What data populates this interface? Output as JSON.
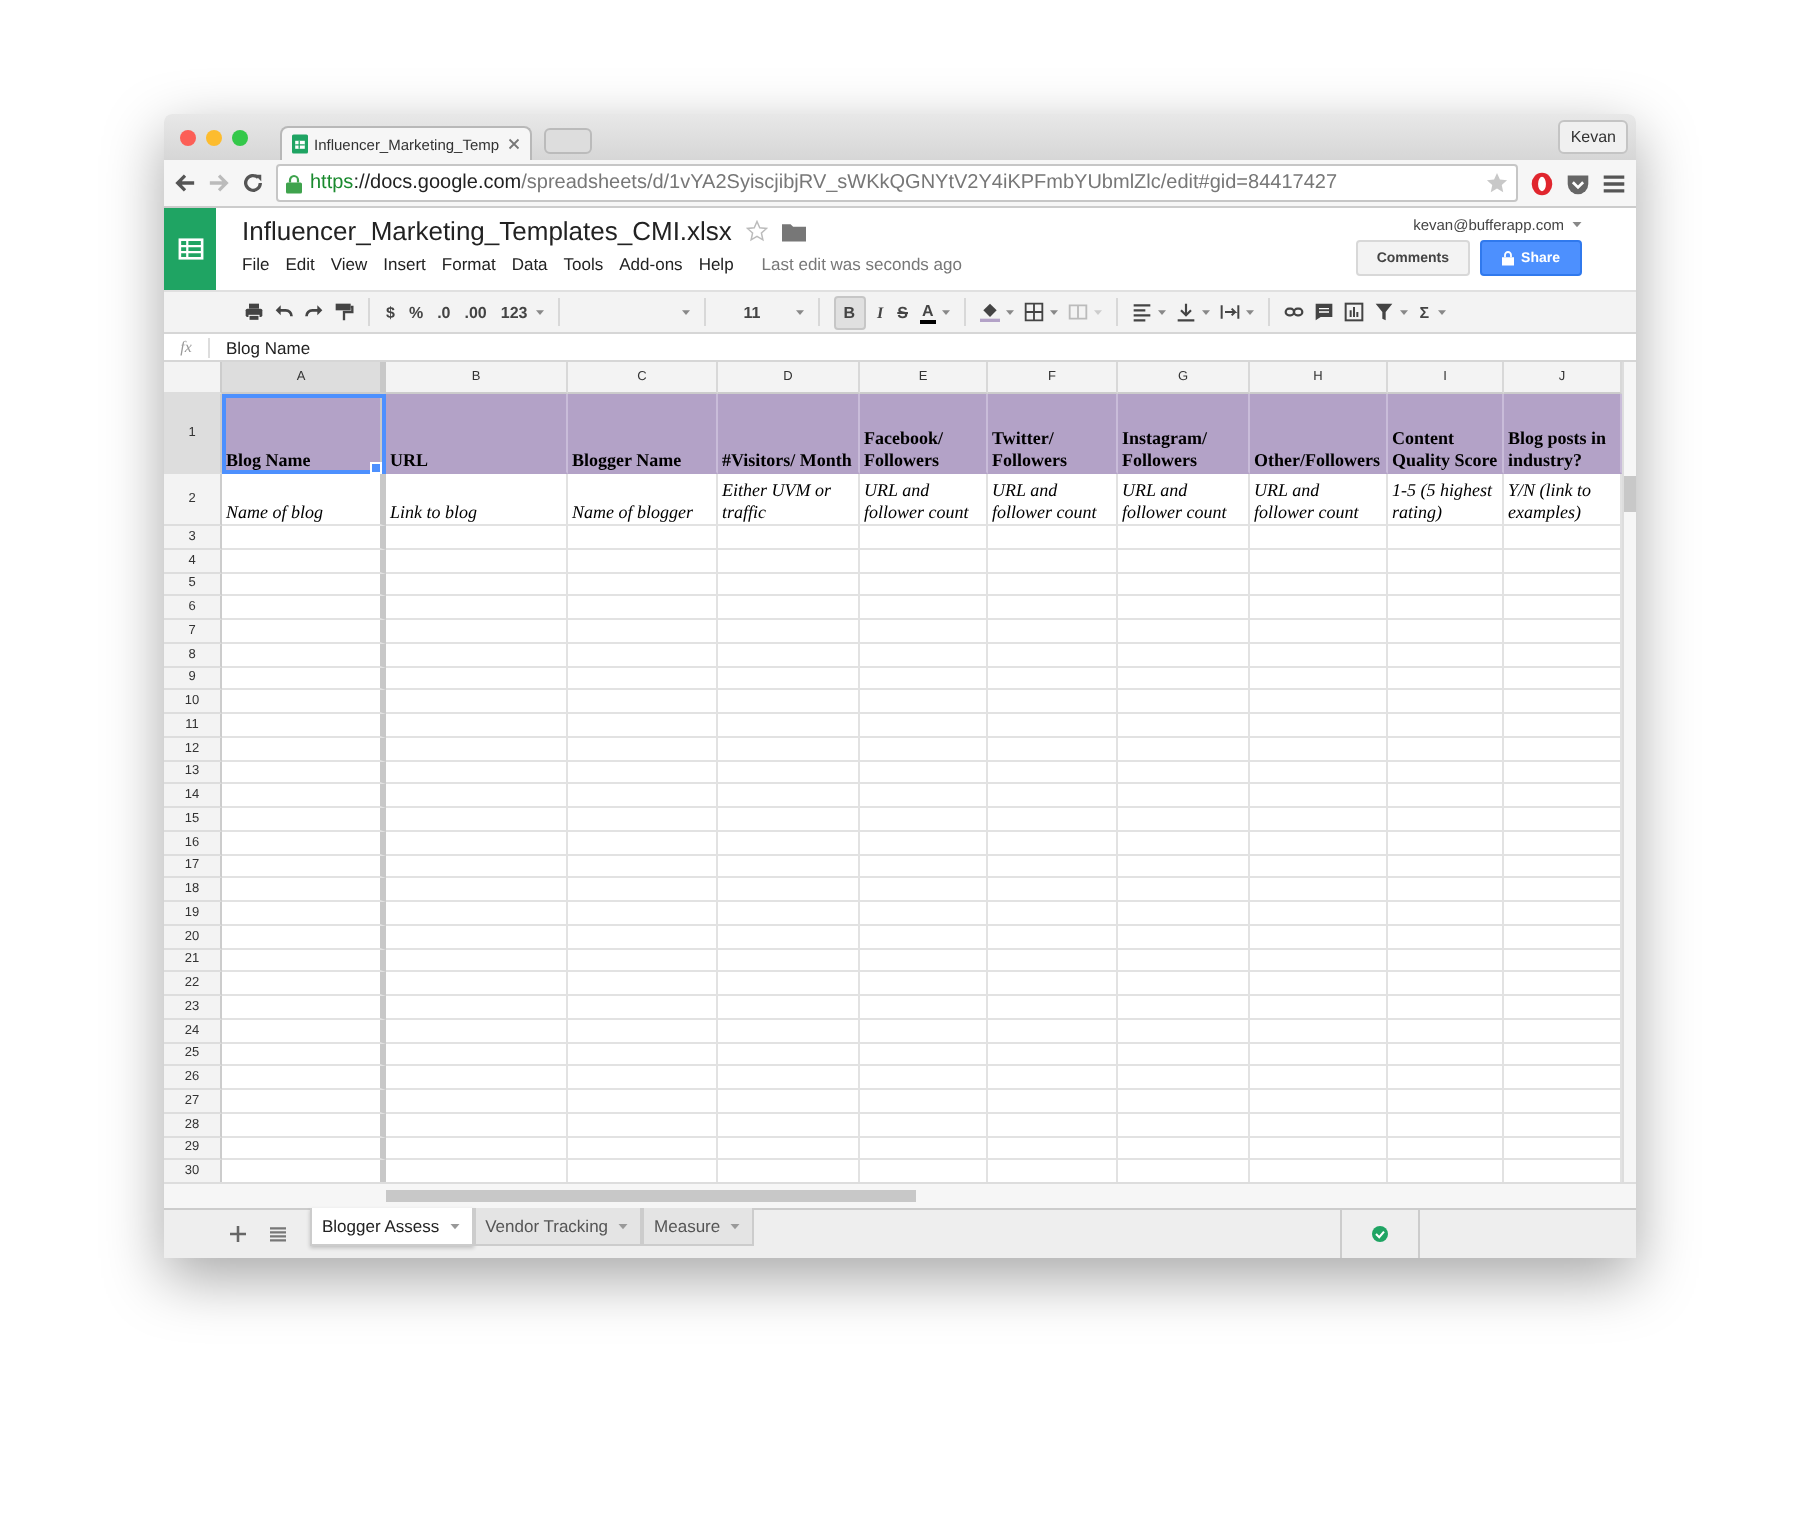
{
  "browser": {
    "tab_title": "Influencer_Marketing_Temp",
    "profile": "Kevan",
    "url": [
      {
        "kind": "scheme",
        "text": "https"
      },
      {
        "kind": "host",
        "text": "://docs.google.com"
      },
      {
        "kind": "path",
        "text": "/spreadsheets/d/1vYA2SyiscjibjRV_sWKkQGNYtV2Y4iKPFmbYUbmlZlc/edit#gid=84417427"
      }
    ]
  },
  "doc": {
    "title": "Influencer_Marketing_Templates_CMI.xlsx",
    "menu": [
      "File",
      "Edit",
      "View",
      "Insert",
      "Format",
      "Data",
      "Tools",
      "Add-ons",
      "Help"
    ],
    "last_edit": "Last edit was seconds ago",
    "account": "kevan@bufferapp.com",
    "comments_button": "Comments",
    "share_button": "Share"
  },
  "toolbar": {
    "currency": "$",
    "percent": "%",
    "decrease_decimals": ".0",
    "increase_decimals": ".00",
    "more_formats": "123",
    "font_size": "11",
    "bold": "B",
    "bold_on": true,
    "italic": "I",
    "strikethrough": "S",
    "text_color": "A",
    "sum": "Σ"
  },
  "formula_bar": {
    "label": "fx",
    "value": "Blog Name"
  },
  "sheet": {
    "columns": [
      {
        "letter": "A",
        "selected": true
      },
      {
        "letter": "B",
        "selected": false
      },
      {
        "letter": "C",
        "selected": false
      },
      {
        "letter": "D",
        "selected": false
      },
      {
        "letter": "E",
        "selected": false
      },
      {
        "letter": "F",
        "selected": false
      },
      {
        "letter": "G",
        "selected": false
      },
      {
        "letter": "H",
        "selected": false
      },
      {
        "letter": "I",
        "selected": false
      },
      {
        "letter": "J",
        "selected": false
      }
    ],
    "rows": [
      {
        "number": "1",
        "kind": "header",
        "selected": true,
        "cells": [
          "Blog Name",
          "URL",
          "Blogger Name",
          "#Visitors/ Month",
          "Facebook/ Followers",
          "Twitter/ Followers",
          "Instagram/ Followers",
          "Other/Followers",
          "Content Quality Score",
          "Blog posts in industry?"
        ]
      },
      {
        "number": "2",
        "kind": "note",
        "selected": false,
        "cells": [
          "Name of blog",
          "Link to blog",
          "Name of blogger",
          "Either UVM or traffic",
          "URL and follower count",
          "URL and follower count",
          "URL and follower count",
          "URL and follower count",
          "1-5 (5 highest rating)",
          "Y/N (link to examples)"
        ]
      },
      {
        "number": "3",
        "kind": "blank",
        "selected": false
      },
      {
        "number": "4",
        "kind": "blank",
        "selected": false
      },
      {
        "number": "5",
        "kind": "blank",
        "selected": false
      },
      {
        "number": "6",
        "kind": "blank",
        "selected": false
      },
      {
        "number": "7",
        "kind": "blank",
        "selected": false
      },
      {
        "number": "8",
        "kind": "blank",
        "selected": false
      },
      {
        "number": "9",
        "kind": "blank",
        "selected": false
      },
      {
        "number": "10",
        "kind": "blank",
        "selected": false
      },
      {
        "number": "11",
        "kind": "blank",
        "selected": false
      },
      {
        "number": "12",
        "kind": "blank",
        "selected": false
      },
      {
        "number": "13",
        "kind": "blank",
        "selected": false
      },
      {
        "number": "14",
        "kind": "blank",
        "selected": false
      },
      {
        "number": "15",
        "kind": "blank",
        "selected": false
      },
      {
        "number": "16",
        "kind": "blank",
        "selected": false
      },
      {
        "number": "17",
        "kind": "blank",
        "selected": false
      },
      {
        "number": "18",
        "kind": "blank",
        "selected": false
      },
      {
        "number": "19",
        "kind": "blank",
        "selected": false
      },
      {
        "number": "20",
        "kind": "blank",
        "selected": false
      },
      {
        "number": "21",
        "kind": "blank",
        "selected": false
      },
      {
        "number": "22",
        "kind": "blank",
        "selected": false
      },
      {
        "number": "23",
        "kind": "blank",
        "selected": false
      },
      {
        "number": "24",
        "kind": "blank",
        "selected": false
      },
      {
        "number": "25",
        "kind": "blank",
        "selected": false
      },
      {
        "number": "26",
        "kind": "blank",
        "selected": false
      },
      {
        "number": "27",
        "kind": "blank",
        "selected": false
      },
      {
        "number": "28",
        "kind": "blank",
        "selected": false
      },
      {
        "number": "29",
        "kind": "blank",
        "selected": false
      },
      {
        "number": "30",
        "kind": "blank",
        "selected": false
      }
    ]
  },
  "sheet_tabs": [
    {
      "label": "Blogger Assess",
      "selected": true
    },
    {
      "label": "Vendor Tracking",
      "selected": false
    },
    {
      "label": "Measure",
      "selected": false
    }
  ]
}
